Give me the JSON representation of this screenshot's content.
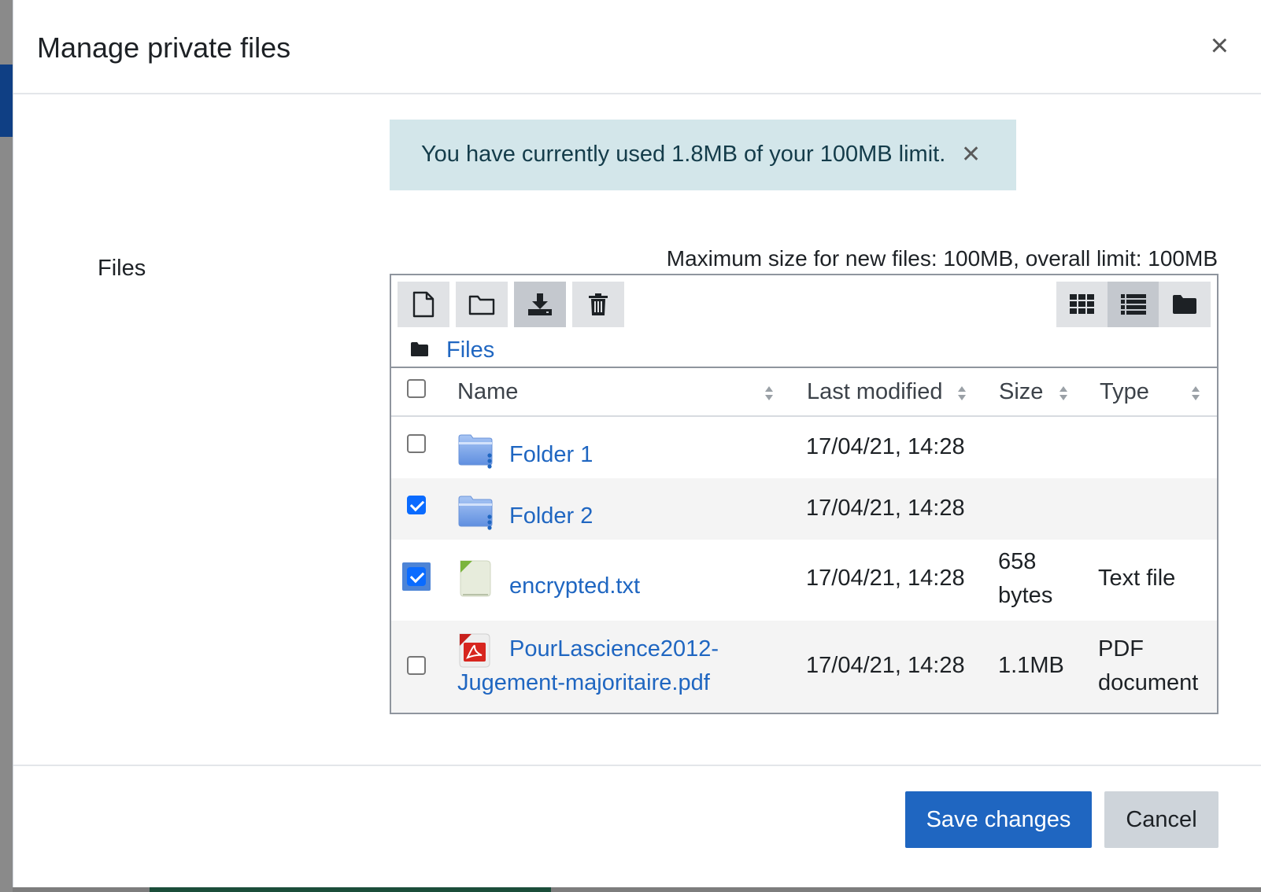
{
  "modal": {
    "title": "Manage private files",
    "close_icon": "close-icon"
  },
  "alert": {
    "text": "You have currently used 1.8MB of your 100MB limit.",
    "close_icon": "close-icon",
    "background": "#d3e6ea"
  },
  "form": {
    "label": "Files",
    "limits": "Maximum size for new files: 100MB, overall limit: 100MB"
  },
  "toolbar": {
    "buttons": [
      {
        "icon": "file-icon",
        "name": "add-file-button"
      },
      {
        "icon": "folder-icon",
        "name": "create-folder-button"
      },
      {
        "icon": "download-icon",
        "name": "download-button"
      },
      {
        "icon": "trash-icon",
        "name": "delete-button"
      }
    ],
    "views": [
      {
        "icon": "grid-icon",
        "name": "view-icons-button"
      },
      {
        "icon": "list-icon",
        "name": "view-details-button",
        "active": true
      },
      {
        "icon": "folder-tree-icon",
        "name": "view-tree-button"
      }
    ]
  },
  "path": {
    "icon": "folder-icon",
    "label": "Files"
  },
  "table": {
    "columns": [
      "Name",
      "Last modified",
      "Size",
      "Type"
    ],
    "rows": [
      {
        "name": "Folder 1",
        "icon": "folder-icon",
        "modified": "17/04/21, 14:28",
        "size": "",
        "type": "",
        "checked": false
      },
      {
        "name": "Folder 2",
        "icon": "folder-icon",
        "modified": "17/04/21, 14:28",
        "size": "",
        "type": "",
        "checked": true
      },
      {
        "name": "encrypted.txt",
        "icon": "text-file-icon",
        "modified": "17/04/21, 14:28",
        "size": "658 bytes",
        "type": "Text file",
        "checked": true
      },
      {
        "name": "PourLascience2012-Jugement-majoritaire.pdf",
        "icon": "pdf-file-icon",
        "modified": "17/04/21, 14:28",
        "size": "1.1MB",
        "type": "PDF document",
        "checked": false
      }
    ]
  },
  "footer": {
    "save_label": "Save changes",
    "cancel_label": "Cancel",
    "primary_color": "#1f66c1"
  }
}
